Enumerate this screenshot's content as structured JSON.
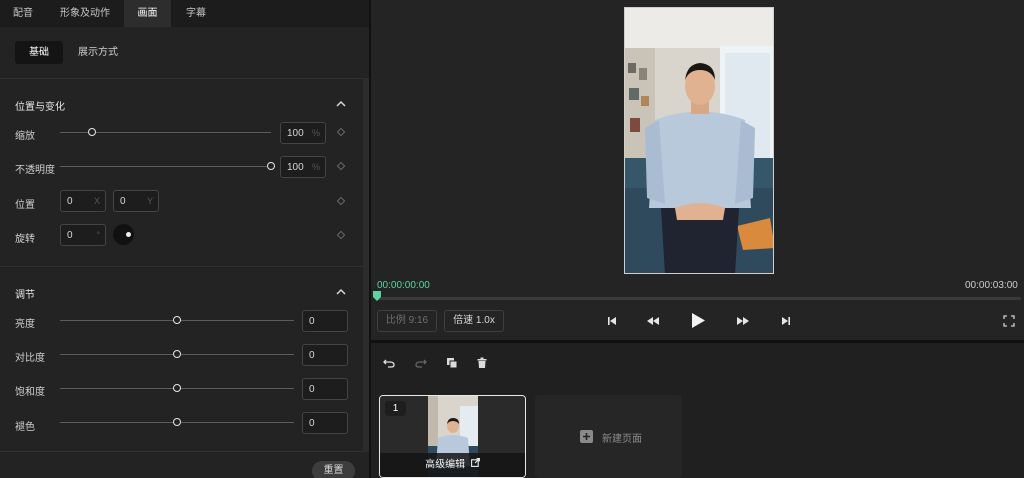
{
  "tabs": [
    {
      "label": "配音",
      "active": false
    },
    {
      "label": "形象及动作",
      "active": false
    },
    {
      "label": "画面",
      "active": true
    },
    {
      "label": "字幕",
      "active": false
    }
  ],
  "subtabs": [
    {
      "label": "基础",
      "active": true
    },
    {
      "label": "展示方式",
      "active": false
    }
  ],
  "position_section": {
    "title": "位置与变化",
    "scale": {
      "label": "缩放",
      "value": "100",
      "unit": "%",
      "level": 0.15
    },
    "opacity": {
      "label": "不透明度",
      "value": "100",
      "unit": "%",
      "level": 1.0
    },
    "position": {
      "label": "位置",
      "x_value": "0",
      "x_unit": "X",
      "y_value": "0",
      "y_unit": "Y"
    },
    "rotation": {
      "label": "旋转",
      "value": "0",
      "unit": "°"
    }
  },
  "adjust_section": {
    "title": "调节",
    "rows": [
      {
        "label": "亮度",
        "value": "0",
        "level": 0.5
      },
      {
        "label": "对比度",
        "value": "0",
        "level": 0.5
      },
      {
        "label": "饱和度",
        "value": "0",
        "level": 0.5
      },
      {
        "label": "褪色",
        "value": "0",
        "level": 0.5
      }
    ]
  },
  "reset_label": "重置",
  "player": {
    "current_time": "00:00:00:00",
    "total_time": "00:00:03:00",
    "ratio_label": "比例 9:16",
    "speed_label": "倍速 1.0x",
    "progress": 0.0
  },
  "timeline": {
    "scene_number": "1",
    "advanced_edit_label": "高级编辑",
    "new_page_label": "新建页面"
  },
  "colors": {
    "accent_green": "#5ed3a0",
    "panel_bg": "#232323"
  },
  "icons": [
    "chevron-up-icon",
    "diamond-keyframe-icon",
    "skip-start-icon",
    "rewind-icon",
    "play-icon",
    "fast-forward-icon",
    "skip-end-icon",
    "fullscreen-icon",
    "undo-icon",
    "redo-icon",
    "copy-icon",
    "trash-icon",
    "plus-icon",
    "external-link-icon"
  ]
}
